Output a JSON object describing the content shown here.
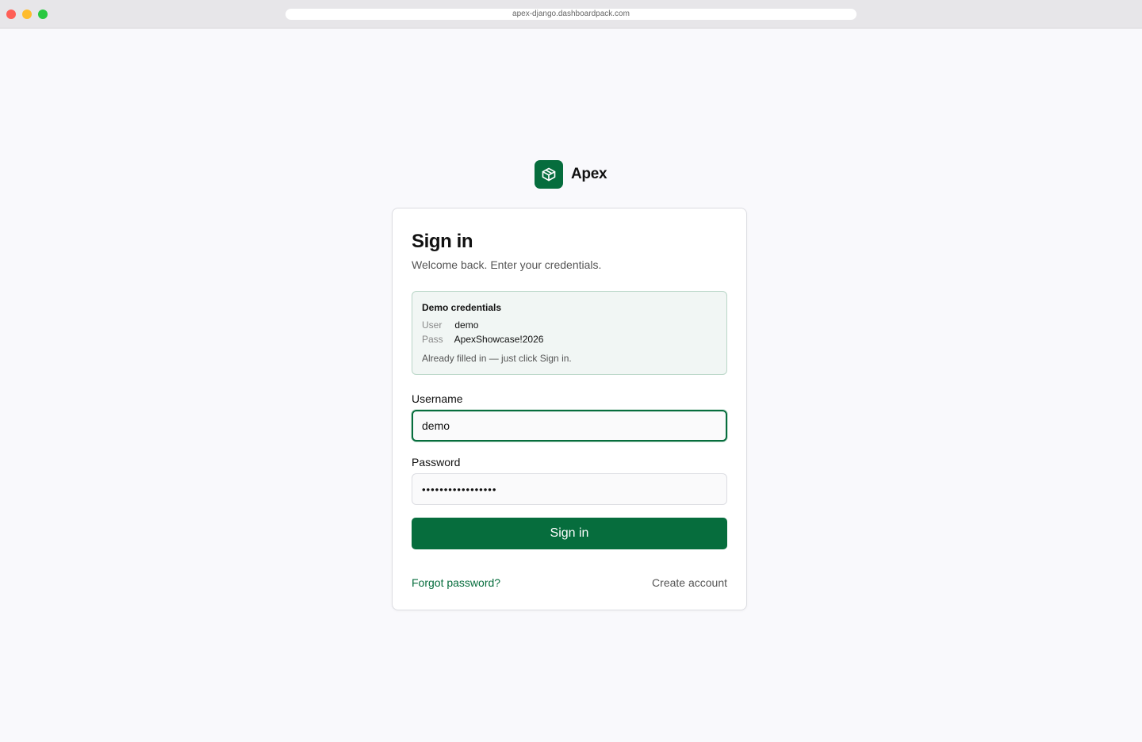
{
  "browser": {
    "url": "apex-django.dashboardpack.com"
  },
  "brand": {
    "name": "Apex",
    "logo_icon": "package-icon",
    "accent_color": "#066d3d"
  },
  "card": {
    "title": "Sign in",
    "subtitle": "Welcome back. Enter your credentials."
  },
  "demo": {
    "title": "Demo credentials",
    "user_key": "User",
    "user_value": "demo",
    "pass_key": "Pass",
    "pass_value": "ApexShowcase!2026",
    "note": "Already filled in — just click Sign in."
  },
  "form": {
    "username_label": "Username",
    "username_value": "demo",
    "password_label": "Password",
    "password_masked": "•••••••••••••••••",
    "submit_label": "Sign in"
  },
  "links": {
    "forgot": "Forgot password?",
    "create": "Create account"
  }
}
